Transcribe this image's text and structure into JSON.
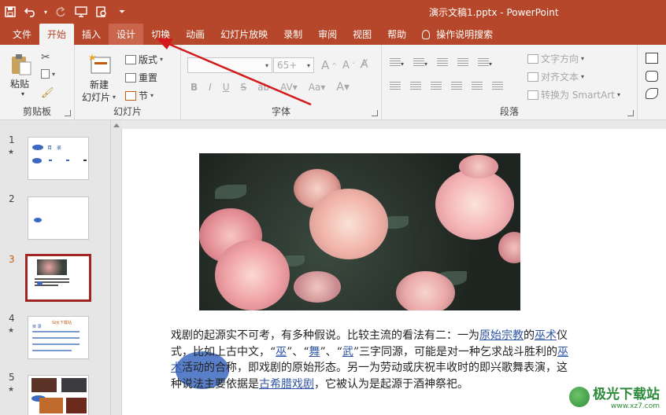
{
  "window": {
    "title": "演示文稿1.pptx  -  PowerPoint"
  },
  "qat": {
    "items": [
      "save-icon",
      "undo-icon",
      "redo-icon",
      "slideshow-icon",
      "preview-icon",
      "customize-icon"
    ]
  },
  "tabs": [
    "文件",
    "开始",
    "插入",
    "设计",
    "切换",
    "动画",
    "幻灯片放映",
    "录制",
    "审阅",
    "视图",
    "帮助"
  ],
  "active_tab": "开始",
  "highlighted_tab": "设计",
  "tell_me": "操作说明搜索",
  "ribbon": {
    "clipboard": {
      "paste": "粘贴",
      "label": "剪贴板"
    },
    "slides": {
      "new_slide_line1": "新建",
      "new_slide_line2": "幻灯片",
      "layout": "版式",
      "reset": "重置",
      "section": "节",
      "label": "幻灯片"
    },
    "font": {
      "font_name": "",
      "font_size": "65+",
      "bold": "B",
      "italic": "I",
      "underline": "U",
      "strike": "S",
      "label": "字体"
    },
    "paragraph": {
      "text_direction": "文字方向",
      "align_text": "对齐文本",
      "smartart": "转换为 SmartArt",
      "label": "段落"
    }
  },
  "thumbnails": [
    {
      "num": "1",
      "star": "★"
    },
    {
      "num": "2",
      "star": ""
    },
    {
      "num": "3",
      "star": ""
    },
    {
      "num": "4",
      "star": "★",
      "caption": "仙女下载站",
      "text": "目  录"
    },
    {
      "num": "5",
      "star": "★"
    }
  ],
  "thumb1_text": "目  录",
  "selected_slide": 3,
  "slide_text": {
    "p1a": "戏剧的起源实不可考，有多种假说。比较主流的看法有二：一为",
    "p1link1": "原始宗教",
    "p1b": "的",
    "p1link2": "巫术",
    "p1c": "仪式，比如上古中文，“",
    "p1link3": "巫",
    "p1d": "”、“",
    "p1link4": "舞",
    "p1e": "”、“",
    "p1link5": "武",
    "p1f": "”三字同源，可能是对一种乞求战斗胜利的",
    "p1link6": "巫术",
    "p1g": "活动的合称，即戏剧的原始形态。另一为劳动或庆祝丰收时的即兴歌舞表演，这种说法主要依据是",
    "p1link7": "古希腊戏剧",
    "p1h": "，它被认为是起源于酒神祭祀。"
  },
  "watermark": {
    "name": "极光下载站",
    "url": "www.xz7.com"
  },
  "colors": {
    "accent": "#b7472a",
    "arrow": "#d3191b",
    "selection": "#a02524",
    "link": "#2f55a4"
  }
}
